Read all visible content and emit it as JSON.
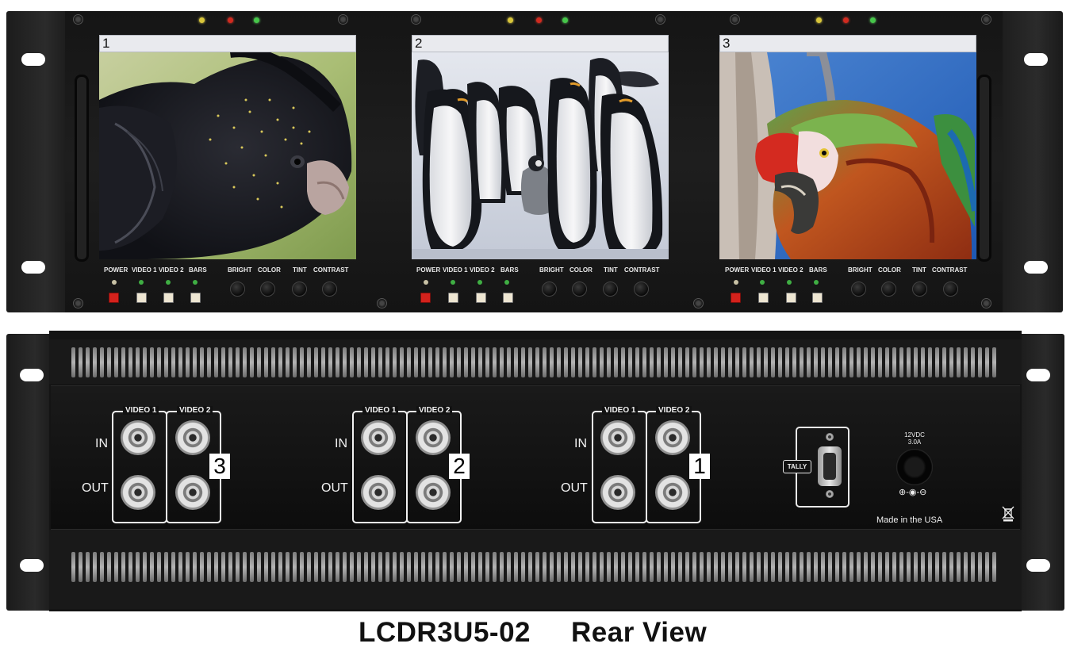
{
  "front_panel": {
    "monitors": [
      {
        "number": "1",
        "subject": "black cockatoo"
      },
      {
        "number": "2",
        "subject": "emperor penguins"
      },
      {
        "number": "3",
        "subject": "macaw parrot"
      }
    ],
    "controls": {
      "power": "POWER",
      "video1": "VIDEO 1",
      "video2": "VIDEO 2",
      "bars": "BARS",
      "bright": "BRIGHT",
      "color": "COLOR",
      "tint": "TINT",
      "contrast": "CONTRAST"
    },
    "led_colors": {
      "yellow": "#d9c63a",
      "red": "#d12a1f",
      "green": "#46c64a"
    }
  },
  "rear_panel": {
    "groups": [
      {
        "number": "3",
        "video1": "VIDEO 1",
        "video2": "VIDEO 2",
        "in": "IN",
        "out": "OUT"
      },
      {
        "number": "2",
        "video1": "VIDEO 1",
        "video2": "VIDEO 2",
        "in": "IN",
        "out": "OUT"
      },
      {
        "number": "1",
        "video1": "VIDEO 1",
        "video2": "VIDEO 2",
        "in": "IN",
        "out": "OUT"
      }
    ],
    "tally": "TALLY",
    "power_rating_line1": "12VDC",
    "power_rating_line2": "3.0A",
    "polarity_symbol": "⊕-◉-⊖",
    "made_in": "Made in the USA",
    "weee_icon": "crossed-bin-icon"
  },
  "caption": {
    "model": "LCDR3U5-02",
    "view": "Rear View"
  }
}
